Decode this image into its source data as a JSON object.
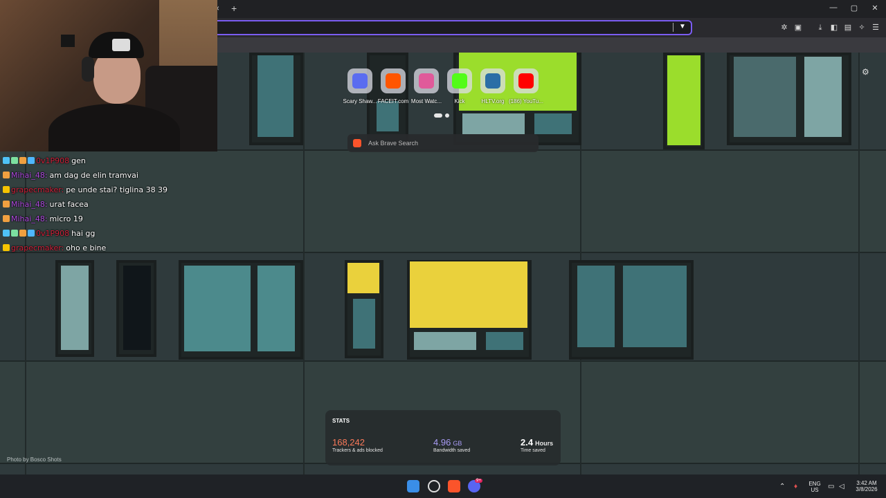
{
  "browser": {
    "tab_close": "×",
    "tab_new": "+",
    "window_controls": [
      "—",
      "▢",
      "✕"
    ]
  },
  "ntp": {
    "photo_credit": "Photo by Bosco Shots",
    "top_sites": [
      {
        "label": "Scary Shaw...",
        "icon": "roblox-icon",
        "color": "#5a6cf0"
      },
      {
        "label": "FACEIT.com",
        "icon": "faceit-icon",
        "color": "#ff5500"
      },
      {
        "label": "Most Watc...",
        "icon": "twitchtracker-icon",
        "color": "#e05a9a"
      },
      {
        "label": "Kick",
        "icon": "kick-icon",
        "color": "#53fc18"
      },
      {
        "label": "HLTV.org",
        "icon": "hltv-icon",
        "color": "#2b6ea6"
      },
      {
        "label": "(186) YouTu...",
        "icon": "youtube-icon",
        "color": "#ff0000"
      }
    ],
    "search_placeholder": "Ask Brave Search",
    "stats": {
      "title": "STATS",
      "trackers_value": "168,242",
      "trackers_label": "Trackers & ads blocked",
      "bandwidth_value": "4.96",
      "bandwidth_unit": "GB",
      "bandwidth_label": "Bandwidth saved",
      "time_value": "2.4",
      "time_unit": "Hours",
      "time_label": "Time saved",
      "colors": {
        "trackers": "#fb7a5a",
        "bandwidth": "#a99cf5",
        "time": "#ffffff"
      }
    }
  },
  "chat": [
    {
      "user": "0v1P908",
      "user_color": "#d0203a",
      "message": "gen"
    },
    {
      "user": "Mihai_48:",
      "user_color": "#b04ae0",
      "message": "am dag de elin tramvai"
    },
    {
      "user": "grapecmaker:",
      "user_color": "#d0203a",
      "message": "pe unde stai? tiglina 38 39"
    },
    {
      "user": "Mihai_48:",
      "user_color": "#b04ae0",
      "message": "urat facea"
    },
    {
      "user": "Mihai_48:",
      "user_color": "#b04ae0",
      "message": "micro 19"
    },
    {
      "user": "0v1P908",
      "user_color": "#d0203a",
      "message": "hai gg"
    },
    {
      "user": "grapecmaker:",
      "user_color": "#d0203a",
      "message": "oho e bine"
    }
  ],
  "taskbar": {
    "lang_top": "ENG",
    "lang_bottom": "US",
    "time": "3:42 AM",
    "date": "3/8/2026",
    "discord_badge": "9+"
  }
}
